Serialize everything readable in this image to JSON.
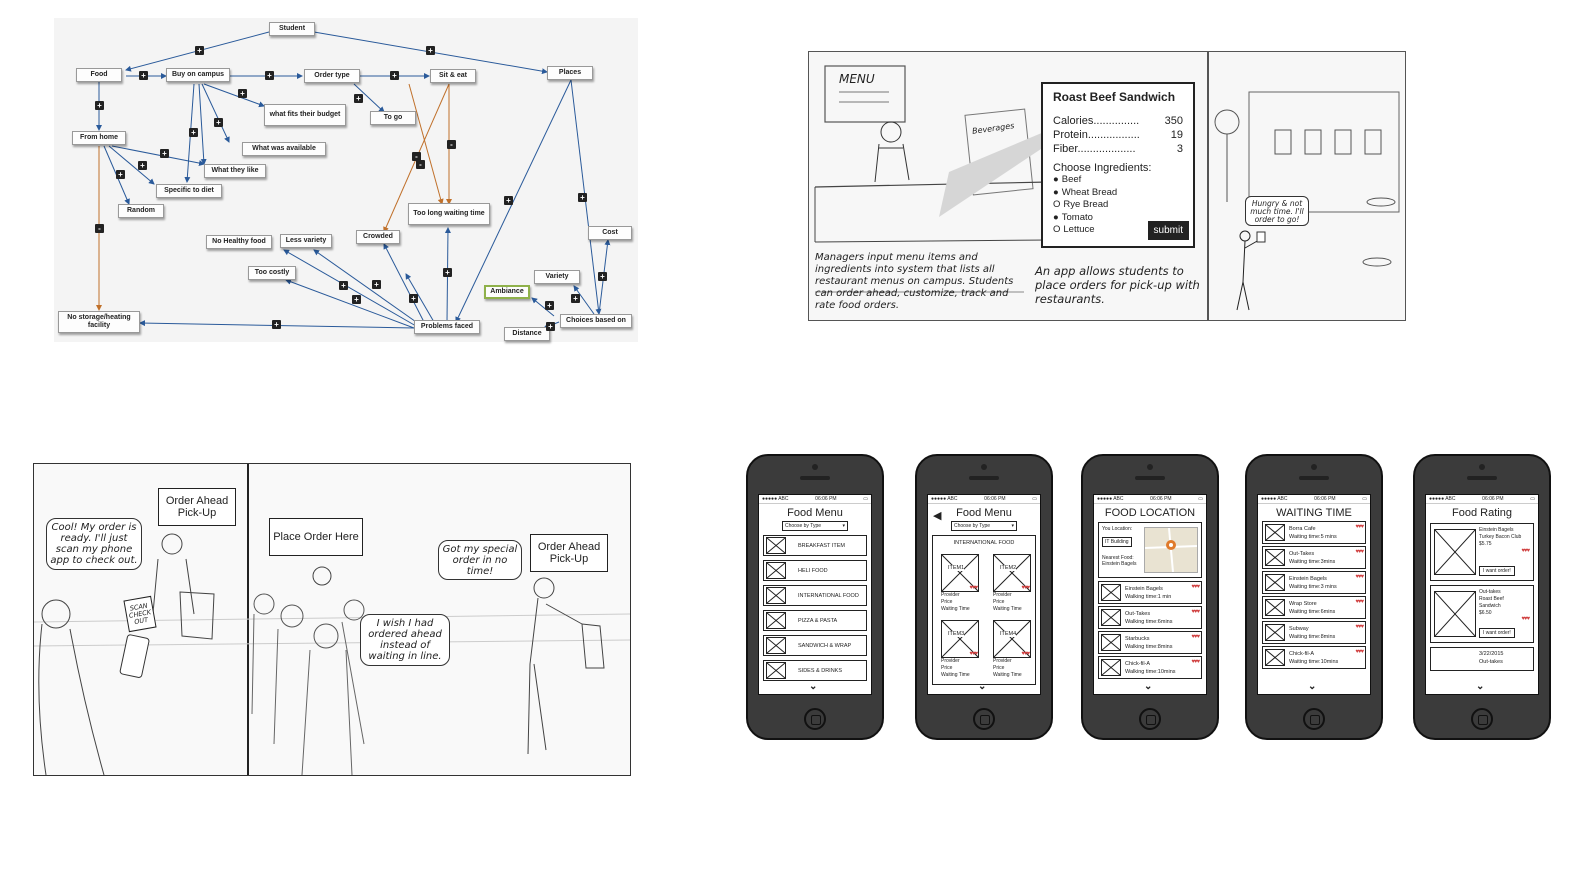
{
  "concept_map": {
    "nodes": {
      "student": "Student",
      "food": "Food",
      "buy_on_campus": "Buy on campus",
      "order_type": "Order type",
      "sit_eat": "Sit & eat",
      "places": "Places",
      "from_home": "From home",
      "fits_budget": "what fits their budget",
      "to_go": "To go",
      "what_available": "What was available",
      "what_they_like": "What they like",
      "specific_diet": "Specific to diet",
      "random": "Random",
      "too_long": "Too long waiting time",
      "crowded": "Crowded",
      "no_healthy": "No Healthy food",
      "less_variety": "Less variety",
      "too_costly": "Too costly",
      "cost": "Cost",
      "variety": "Variety",
      "ambiance": "Ambiance",
      "no_storage": "No storage/heating facility",
      "problems": "Problems faced",
      "choices": "Choices based on",
      "distance": "Distance"
    },
    "plus_sign": "+",
    "minus_sign": "-"
  },
  "storyboard_top": {
    "menu_sign": "MENU",
    "beverages_sign": "Beverages",
    "card_title": "Roast Beef Sandwich",
    "nutrition": [
      {
        "label": "Calories...............",
        "value": "350"
      },
      {
        "label": "Protein.................",
        "value": "19"
      },
      {
        "label": "Fiber...................",
        "value": "3"
      }
    ],
    "choose_label": "Choose Ingredients:",
    "ingredients": [
      {
        "bullet": "●",
        "name": "Beef"
      },
      {
        "bullet": "●",
        "name": "Wheat Bread"
      },
      {
        "bullet": "O",
        "name": "Rye Bread"
      },
      {
        "bullet": "●",
        "name": "Tomato"
      },
      {
        "bullet": "O",
        "name": "Lettuce"
      }
    ],
    "submit": "submit",
    "caption_left": "Managers input menu items and ingredients into system that lists all restaurant menus on campus. Students can order ahead, customize, track and rate food orders.",
    "caption_right": "An app allows students to place orders for pick-up with restaurants.",
    "bubble": "Hungry & not much time. I'll order to go!"
  },
  "storyboard_bottom": {
    "bubble1": "Cool! My order is ready. I'll just scan my phone app to check out.",
    "sign1": "Order Ahead Pick-Up",
    "scan_sign": "SCAN CHECK OUT",
    "sign2": "Place Order Here",
    "bubble2": "I wish I had ordered ahead instead of waiting in line.",
    "bubble3": "Got my special order in no time!",
    "sign3": "Order Ahead Pick-Up"
  },
  "phones": {
    "status_left": "●●●●● ABC",
    "status_time": "06:06 PM",
    "phone1": {
      "title": "Food Menu",
      "chooser": "Choose by Type",
      "items": [
        "BREAKFAST ITEM",
        "HELI FOOD",
        "INTERNATIONAL FOOD",
        "PIZZA & PASTA",
        "SANDWICH & WRAP",
        "SIDES & DRINKS"
      ]
    },
    "phone2": {
      "title": "Food Menu",
      "chooser": "Choose by Type",
      "section": "INTERNATIONAL FOOD",
      "items": [
        {
          "name": "ITEM1",
          "lines": [
            "Provider",
            "Price",
            "Waiting Time"
          ]
        },
        {
          "name": "ITEM2",
          "lines": [
            "Provider",
            "Price",
            "Waiting Time"
          ]
        },
        {
          "name": "ITEM3",
          "lines": [
            "Provider",
            "Price",
            "Waiting Time"
          ]
        },
        {
          "name": "ITEM4",
          "lines": [
            "Provider",
            "Price",
            "Waiting Time"
          ]
        }
      ]
    },
    "phone3": {
      "title": "FOOD LOCATION",
      "your_location": "You Location:",
      "location_value": "IT Building",
      "nearest": "Nearest Food: Einstein Bagels",
      "items": [
        {
          "name": "Einstein Bagels",
          "detail": "Walking time:1 min"
        },
        {
          "name": "Out-Takes",
          "detail": "Walking time:6mins"
        },
        {
          "name": "Starbucks",
          "detail": "Walking time:8mins"
        },
        {
          "name": "Chick-fil-A",
          "detail": "Walking time:10mins"
        }
      ]
    },
    "phone4": {
      "title": "WAITING TIME",
      "items": [
        {
          "name": "Borra Cafe",
          "detail": "Waiting time:5 mins"
        },
        {
          "name": "Out-Takes",
          "detail": "Waiting time:3mins"
        },
        {
          "name": "Einstein Bagels",
          "detail": "Waiting time:3 mins"
        },
        {
          "name": "Wrap Store",
          "detail": "Waiting time:6mins"
        },
        {
          "name": "Subway",
          "detail": "Waiting time:8mins"
        },
        {
          "name": "Chick-fil-A",
          "detail": "Waiting time:10mins"
        }
      ]
    },
    "phone5": {
      "title": "Food Rating",
      "items": [
        {
          "lines": [
            "Einstein Bagels",
            "Turkey Bacon Club",
            "$5.75"
          ],
          "button": "I want order!"
        },
        {
          "lines": [
            "Out-takes",
            "Roast Beef",
            "Sandwich",
            "$6.50"
          ],
          "button": "I want order!"
        }
      ],
      "last_date": "3/22/2015",
      "last_name": "Out-takes"
    },
    "hearts": "♥♥♥"
  }
}
